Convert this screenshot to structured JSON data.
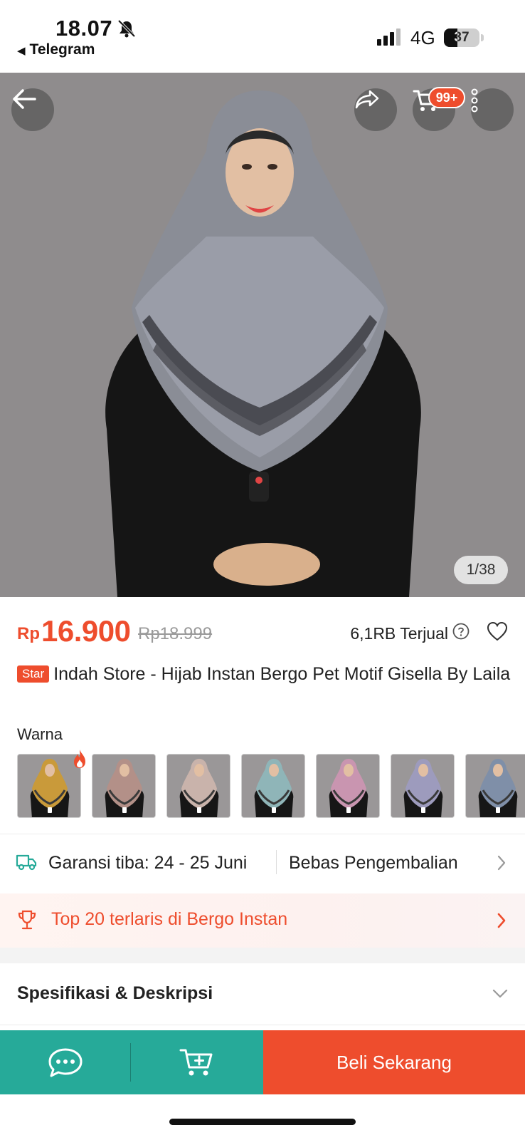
{
  "status_bar": {
    "time": "18.07",
    "back_app": "Telegram",
    "network": "4G",
    "battery": "37",
    "battery_level": 0.37,
    "icons": [
      "bell-slash-icon",
      "signal-icon"
    ]
  },
  "header": {
    "back": "back-arrow-icon",
    "share": "share-icon",
    "cart": "cart-icon",
    "cart_badge": "99+",
    "more": "more-vertical-icon"
  },
  "gallery": {
    "counter": "1/38"
  },
  "product": {
    "currency": "Rp",
    "price": "16.900",
    "original_price": "Rp18.999",
    "sold": "6,1RB Terjual",
    "store_badge": "Star",
    "title": "Indah Store - Hijab Instan Bergo Pet Motif Gisella By Laila"
  },
  "variants": {
    "label": "Warna",
    "colors": [
      "#c99a3a",
      "#b39088",
      "#c9b3ab",
      "#8fb5b8",
      "#c995b0",
      "#9d9bbd",
      "#7f8fa8"
    ]
  },
  "shipping": {
    "guarantee": "Garansi tiba: 24 - 25 Juni",
    "returns": "Bebas Pengembalian"
  },
  "ranking": {
    "text": "Top 20 terlaris di Bergo Instan"
  },
  "spec": {
    "title": "Spesifikasi & Deskripsi"
  },
  "bottom_bar": {
    "buy_label": "Beli Sekarang"
  },
  "colors": {
    "accent": "#ee4d2d",
    "secondary": "#26aa99"
  }
}
